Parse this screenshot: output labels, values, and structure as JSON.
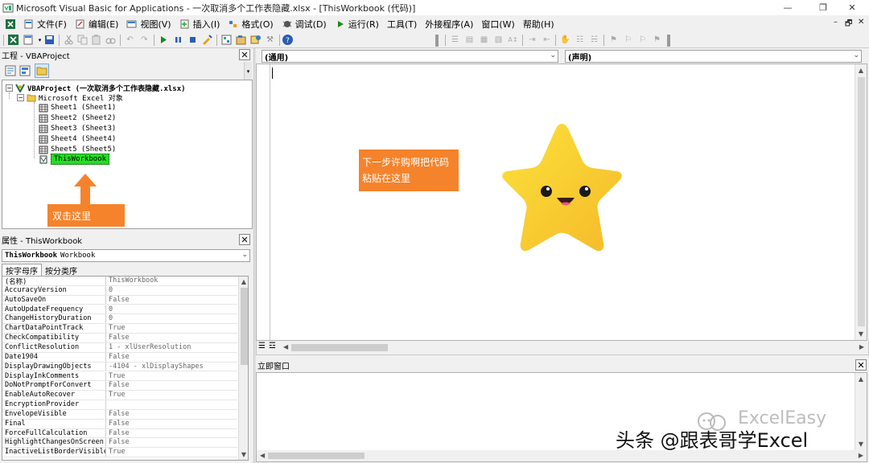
{
  "window": {
    "title": "Microsoft Visual Basic for Applications - 一次取消多个工作表隐藏.xlsx - [ThisWorkbook (代码)]",
    "controls": {
      "minimize": "—",
      "restore": "❐",
      "close": "✕"
    }
  },
  "menu": {
    "items": [
      "文件(F)",
      "编辑(E)",
      "视图(V)",
      "插入(I)",
      "格式(O)",
      "调试(D)",
      "运行(R)",
      "工具(T)",
      "外接程序(A)",
      "窗口(W)",
      "帮助(H)"
    ],
    "mdi_controls": {
      "minimize": "–",
      "restore": "🗗",
      "close": "✕"
    }
  },
  "project": {
    "title": "工程 - VBAProject",
    "close_glyph": "✕",
    "root": "VBAProject (一次取消多个工作表隐藏.xlsx)",
    "folder": "Microsoft Excel 对象",
    "sheets": [
      "Sheet1 (Sheet1)",
      "Sheet2 (Sheet2)",
      "Sheet3 (Sheet3)",
      "Sheet4 (Sheet4)",
      "Sheet5 (Sheet5)"
    ],
    "workbook": "ThisWorkbook"
  },
  "properties": {
    "title": "属性 - ThisWorkbook",
    "close_glyph": "✕",
    "object_name": "ThisWorkbook",
    "object_type": "Workbook",
    "tabs": [
      "按字母序",
      "按分类序"
    ],
    "rows": [
      {
        "name": "(名称)",
        "value": "ThisWorkbook"
      },
      {
        "name": "AccuracyVersion",
        "value": "0"
      },
      {
        "name": "AutoSaveOn",
        "value": "False"
      },
      {
        "name": "AutoUpdateFrequency",
        "value": "0"
      },
      {
        "name": "ChangeHistoryDuration",
        "value": "0"
      },
      {
        "name": "ChartDataPointTrack",
        "value": "True"
      },
      {
        "name": "CheckCompatibility",
        "value": "False"
      },
      {
        "name": "ConflictResolution",
        "value": "1 - xlUserResolution"
      },
      {
        "name": "Date1904",
        "value": "False"
      },
      {
        "name": "DisplayDrawingObjects",
        "value": "-4104 - xlDisplayShapes"
      },
      {
        "name": "DisplayInkComments",
        "value": "True"
      },
      {
        "name": "DoNotPromptForConvert",
        "value": "False"
      },
      {
        "name": "EnableAutoRecover",
        "value": "True"
      },
      {
        "name": "EncryptionProvider",
        "value": ""
      },
      {
        "name": "EnvelopeVisible",
        "value": "False"
      },
      {
        "name": "Final",
        "value": "False"
      },
      {
        "name": "ForceFullCalculation",
        "value": "False"
      },
      {
        "name": "HighlightChangesOnScreen",
        "value": "False"
      },
      {
        "name": "InactiveListBorderVisible",
        "value": "True"
      }
    ]
  },
  "code": {
    "object_combo": "(通用)",
    "proc_combo": "(声明)"
  },
  "immediate": {
    "title": "立即窗口",
    "close_glyph": "✕"
  },
  "annotations": {
    "double_click": "双击这里",
    "paste_line1": "下一步许购啊把代码",
    "paste_line2": "粘贴在这里"
  },
  "watermark": {
    "logo": "ExcelEasy",
    "credit": "头条 @跟表哥学Excel"
  },
  "colors": {
    "callout": "#f5832b",
    "selected": "#22dd22",
    "star": "#f9c52d"
  }
}
